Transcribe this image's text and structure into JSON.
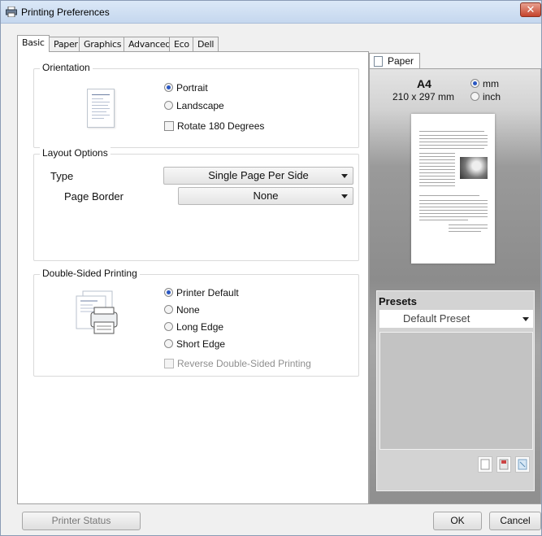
{
  "window": {
    "title": "Printing Preferences",
    "close_label": "✕"
  },
  "tabs": [
    {
      "label": "Basic"
    },
    {
      "label": "Paper"
    },
    {
      "label": "Graphics"
    },
    {
      "label": "Advanced"
    },
    {
      "label": "Eco"
    },
    {
      "label": "Dell"
    }
  ],
  "orientation": {
    "label": "Orientation",
    "options": [
      {
        "label": "Portrait",
        "selected": true
      },
      {
        "label": "Landscape",
        "selected": false
      }
    ],
    "rotate_label": "Rotate 180 Degrees"
  },
  "layout": {
    "label": "Layout Options",
    "type_label": "Type",
    "type_value": "Single Page Per Side",
    "border_label": "Page Border",
    "border_value": "None"
  },
  "duplex": {
    "label": "Double-Sided Printing",
    "options": [
      {
        "label": "Printer Default",
        "selected": true
      },
      {
        "label": "None",
        "selected": false
      },
      {
        "label": "Long Edge",
        "selected": false
      },
      {
        "label": "Short Edge",
        "selected": false
      }
    ],
    "reverse_label": "Reverse Double-Sided Printing"
  },
  "preview": {
    "tab_label": "Paper",
    "size_name": "A4",
    "size_dims": "210 x 297 mm",
    "unit_mm": "mm",
    "unit_inch": "inch"
  },
  "presets": {
    "label": "Presets",
    "selected": "Default Preset"
  },
  "footer": {
    "printer_status": "Printer Status",
    "ok": "OK",
    "cancel": "Cancel"
  }
}
